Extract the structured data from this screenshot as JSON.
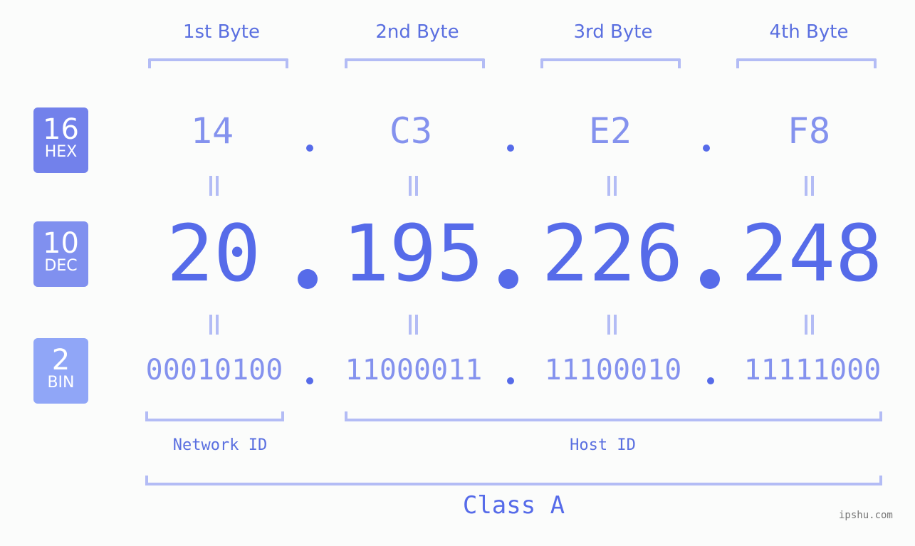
{
  "byte_headers": [
    "1st Byte",
    "2nd Byte",
    "3rd Byte",
    "4th Byte"
  ],
  "bases": [
    {
      "number": "16",
      "label": "HEX",
      "color": "#7281eb"
    },
    {
      "number": "10",
      "label": "DEC",
      "color": "#8090ef"
    },
    {
      "number": "2",
      "label": "BIN",
      "color": "#90a6f7"
    }
  ],
  "hex": [
    "14",
    "C3",
    "E2",
    "F8"
  ],
  "dec": [
    "20",
    "195",
    "226",
    "248"
  ],
  "bin": [
    "00010100",
    "11000011",
    "11100010",
    "11111000"
  ],
  "network_label": "Network ID",
  "host_label": "Host ID",
  "class_label": "Class A",
  "watermark": "ipshu.com",
  "colors": {
    "accent": "#566be9",
    "light_accent": "#8492ee",
    "bracket": "#b3bcf5"
  }
}
